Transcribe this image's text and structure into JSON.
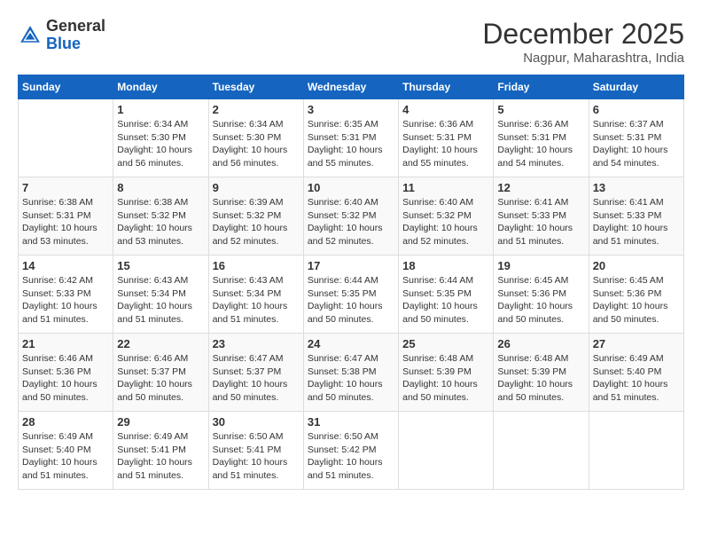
{
  "header": {
    "logo_general": "General",
    "logo_blue": "Blue",
    "month_title": "December 2025",
    "location": "Nagpur, Maharashtra, India"
  },
  "days_of_week": [
    "Sunday",
    "Monday",
    "Tuesday",
    "Wednesday",
    "Thursday",
    "Friday",
    "Saturday"
  ],
  "weeks": [
    [
      {
        "day": "",
        "sunrise": "",
        "sunset": "",
        "daylight": ""
      },
      {
        "day": "1",
        "sunrise": "Sunrise: 6:34 AM",
        "sunset": "Sunset: 5:30 PM",
        "daylight": "Daylight: 10 hours and 56 minutes."
      },
      {
        "day": "2",
        "sunrise": "Sunrise: 6:34 AM",
        "sunset": "Sunset: 5:30 PM",
        "daylight": "Daylight: 10 hours and 56 minutes."
      },
      {
        "day": "3",
        "sunrise": "Sunrise: 6:35 AM",
        "sunset": "Sunset: 5:31 PM",
        "daylight": "Daylight: 10 hours and 55 minutes."
      },
      {
        "day": "4",
        "sunrise": "Sunrise: 6:36 AM",
        "sunset": "Sunset: 5:31 PM",
        "daylight": "Daylight: 10 hours and 55 minutes."
      },
      {
        "day": "5",
        "sunrise": "Sunrise: 6:36 AM",
        "sunset": "Sunset: 5:31 PM",
        "daylight": "Daylight: 10 hours and 54 minutes."
      },
      {
        "day": "6",
        "sunrise": "Sunrise: 6:37 AM",
        "sunset": "Sunset: 5:31 PM",
        "daylight": "Daylight: 10 hours and 54 minutes."
      }
    ],
    [
      {
        "day": "7",
        "sunrise": "Sunrise: 6:38 AM",
        "sunset": "Sunset: 5:31 PM",
        "daylight": "Daylight: 10 hours and 53 minutes."
      },
      {
        "day": "8",
        "sunrise": "Sunrise: 6:38 AM",
        "sunset": "Sunset: 5:32 PM",
        "daylight": "Daylight: 10 hours and 53 minutes."
      },
      {
        "day": "9",
        "sunrise": "Sunrise: 6:39 AM",
        "sunset": "Sunset: 5:32 PM",
        "daylight": "Daylight: 10 hours and 52 minutes."
      },
      {
        "day": "10",
        "sunrise": "Sunrise: 6:40 AM",
        "sunset": "Sunset: 5:32 PM",
        "daylight": "Daylight: 10 hours and 52 minutes."
      },
      {
        "day": "11",
        "sunrise": "Sunrise: 6:40 AM",
        "sunset": "Sunset: 5:32 PM",
        "daylight": "Daylight: 10 hours and 52 minutes."
      },
      {
        "day": "12",
        "sunrise": "Sunrise: 6:41 AM",
        "sunset": "Sunset: 5:33 PM",
        "daylight": "Daylight: 10 hours and 51 minutes."
      },
      {
        "day": "13",
        "sunrise": "Sunrise: 6:41 AM",
        "sunset": "Sunset: 5:33 PM",
        "daylight": "Daylight: 10 hours and 51 minutes."
      }
    ],
    [
      {
        "day": "14",
        "sunrise": "Sunrise: 6:42 AM",
        "sunset": "Sunset: 5:33 PM",
        "daylight": "Daylight: 10 hours and 51 minutes."
      },
      {
        "day": "15",
        "sunrise": "Sunrise: 6:43 AM",
        "sunset": "Sunset: 5:34 PM",
        "daylight": "Daylight: 10 hours and 51 minutes."
      },
      {
        "day": "16",
        "sunrise": "Sunrise: 6:43 AM",
        "sunset": "Sunset: 5:34 PM",
        "daylight": "Daylight: 10 hours and 51 minutes."
      },
      {
        "day": "17",
        "sunrise": "Sunrise: 6:44 AM",
        "sunset": "Sunset: 5:35 PM",
        "daylight": "Daylight: 10 hours and 50 minutes."
      },
      {
        "day": "18",
        "sunrise": "Sunrise: 6:44 AM",
        "sunset": "Sunset: 5:35 PM",
        "daylight": "Daylight: 10 hours and 50 minutes."
      },
      {
        "day": "19",
        "sunrise": "Sunrise: 6:45 AM",
        "sunset": "Sunset: 5:36 PM",
        "daylight": "Daylight: 10 hours and 50 minutes."
      },
      {
        "day": "20",
        "sunrise": "Sunrise: 6:45 AM",
        "sunset": "Sunset: 5:36 PM",
        "daylight": "Daylight: 10 hours and 50 minutes."
      }
    ],
    [
      {
        "day": "21",
        "sunrise": "Sunrise: 6:46 AM",
        "sunset": "Sunset: 5:36 PM",
        "daylight": "Daylight: 10 hours and 50 minutes."
      },
      {
        "day": "22",
        "sunrise": "Sunrise: 6:46 AM",
        "sunset": "Sunset: 5:37 PM",
        "daylight": "Daylight: 10 hours and 50 minutes."
      },
      {
        "day": "23",
        "sunrise": "Sunrise: 6:47 AM",
        "sunset": "Sunset: 5:37 PM",
        "daylight": "Daylight: 10 hours and 50 minutes."
      },
      {
        "day": "24",
        "sunrise": "Sunrise: 6:47 AM",
        "sunset": "Sunset: 5:38 PM",
        "daylight": "Daylight: 10 hours and 50 minutes."
      },
      {
        "day": "25",
        "sunrise": "Sunrise: 6:48 AM",
        "sunset": "Sunset: 5:39 PM",
        "daylight": "Daylight: 10 hours and 50 minutes."
      },
      {
        "day": "26",
        "sunrise": "Sunrise: 6:48 AM",
        "sunset": "Sunset: 5:39 PM",
        "daylight": "Daylight: 10 hours and 50 minutes."
      },
      {
        "day": "27",
        "sunrise": "Sunrise: 6:49 AM",
        "sunset": "Sunset: 5:40 PM",
        "daylight": "Daylight: 10 hours and 51 minutes."
      }
    ],
    [
      {
        "day": "28",
        "sunrise": "Sunrise: 6:49 AM",
        "sunset": "Sunset: 5:40 PM",
        "daylight": "Daylight: 10 hours and 51 minutes."
      },
      {
        "day": "29",
        "sunrise": "Sunrise: 6:49 AM",
        "sunset": "Sunset: 5:41 PM",
        "daylight": "Daylight: 10 hours and 51 minutes."
      },
      {
        "day": "30",
        "sunrise": "Sunrise: 6:50 AM",
        "sunset": "Sunset: 5:41 PM",
        "daylight": "Daylight: 10 hours and 51 minutes."
      },
      {
        "day": "31",
        "sunrise": "Sunrise: 6:50 AM",
        "sunset": "Sunset: 5:42 PM",
        "daylight": "Daylight: 10 hours and 51 minutes."
      },
      {
        "day": "",
        "sunrise": "",
        "sunset": "",
        "daylight": ""
      },
      {
        "day": "",
        "sunrise": "",
        "sunset": "",
        "daylight": ""
      },
      {
        "day": "",
        "sunrise": "",
        "sunset": "",
        "daylight": ""
      }
    ]
  ]
}
